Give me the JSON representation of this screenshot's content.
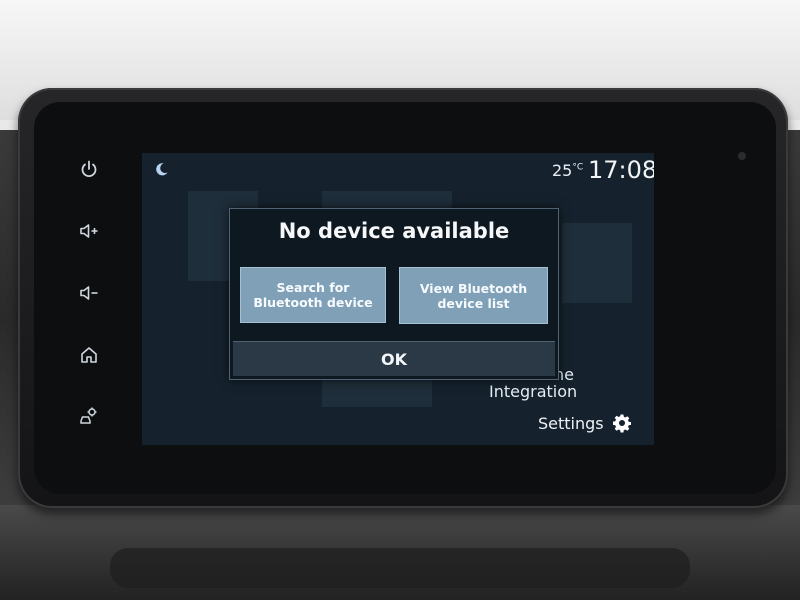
{
  "status_bar": {
    "night_mode_icon": "moon-icon",
    "temperature": "25",
    "temperature_unit": "°C",
    "time": "17:08"
  },
  "side_controls": [
    {
      "name": "power-icon"
    },
    {
      "name": "volume-up-icon"
    },
    {
      "name": "volume-down-icon"
    },
    {
      "name": "home-icon"
    },
    {
      "name": "car-settings-icon"
    }
  ],
  "background": {
    "partial_label": "ne",
    "integration_label": "Integration",
    "settings_label": "Settings",
    "settings_icon": "gear-icon"
  },
  "dialog": {
    "title": "No device available",
    "search_button": "Search for Bluetooth device",
    "view_list_button": "View Bluetooth device list",
    "ok_button": "OK"
  },
  "colors": {
    "screen_bg": "#15222d",
    "dialog_button": "#7fa0b6",
    "accent_icon": "#b8d3ef"
  }
}
